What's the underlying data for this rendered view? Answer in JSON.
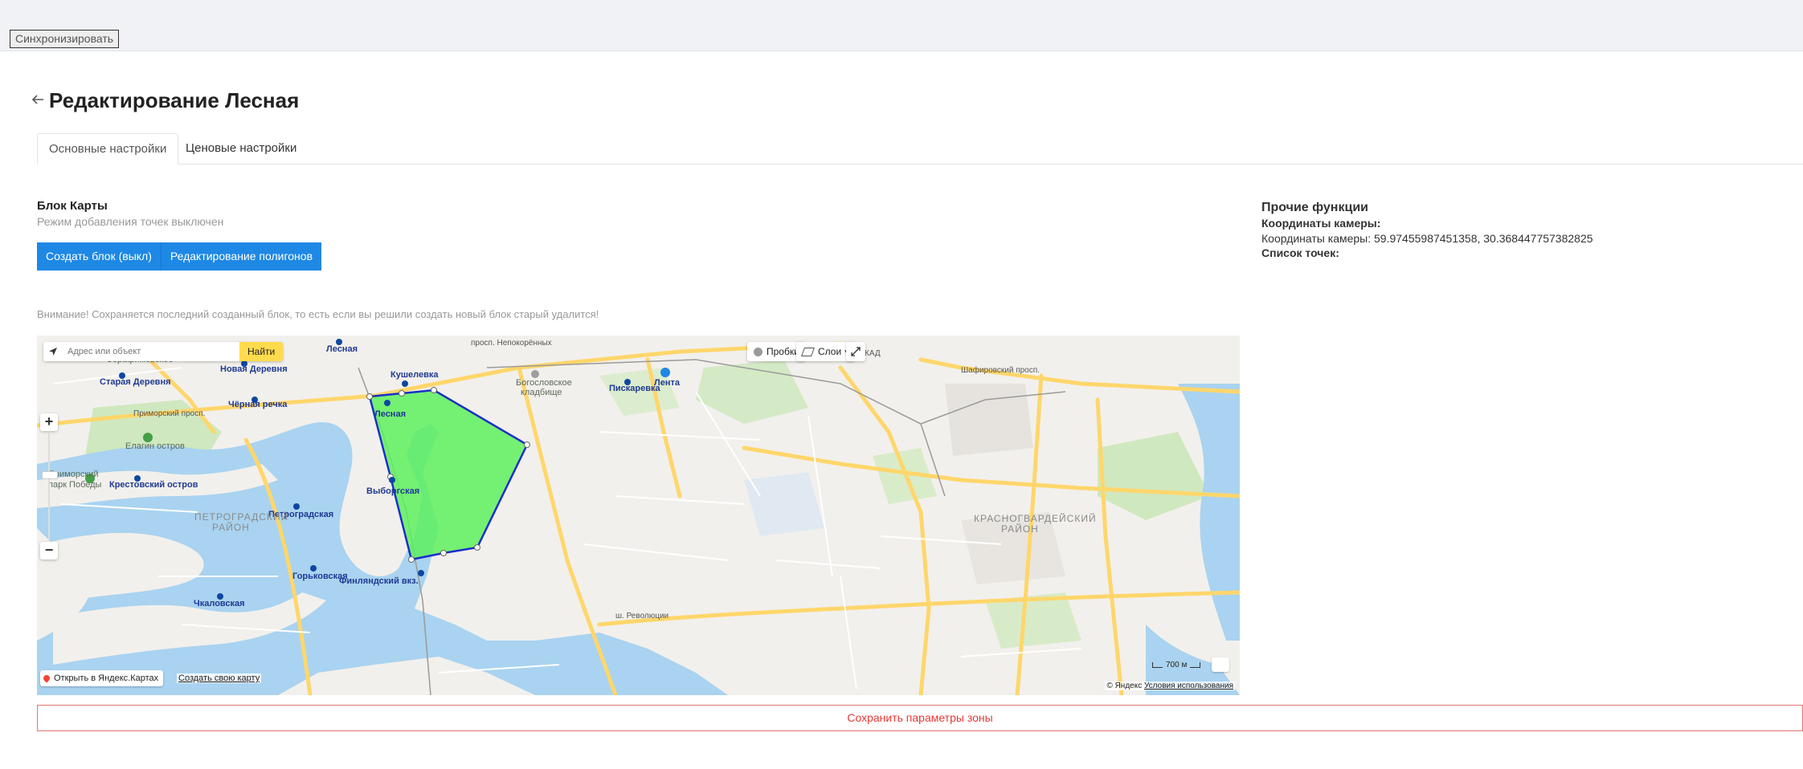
{
  "header": {
    "sync_label": "Синхронизировать"
  },
  "page": {
    "title": "Редактирование Лесная"
  },
  "tabs": [
    {
      "label": "Основные настройки",
      "active": true
    },
    {
      "label": "Ценовые настройки",
      "active": false
    }
  ],
  "map_block": {
    "title": "Блок Карты",
    "subtitle": "Режим добавления точек выключен",
    "buttons": [
      {
        "label": "Создать блок (выкл)"
      },
      {
        "label": "Редактирование полигонов"
      }
    ],
    "warning": "Внимание! Сохраняется последний созданный блок, то есть если вы решили создать новый блок старый удалится!"
  },
  "other_functions": {
    "title": "Прочие функции",
    "camera_label": "Координаты камеры:",
    "camera_value": "Координаты камеры: 59.97455987451358, 30.368447757382825",
    "points_label": "Список точек:"
  },
  "map": {
    "search_placeholder": "Адрес или объект",
    "find_label": "Найти",
    "traffic_label": "Пробки",
    "layers_label": "Слои",
    "open_yandex": "Открыть в Яндекс.Картах",
    "create_map": "Создать свою карту",
    "copyright": "© Яндекс",
    "terms": "Условия использования",
    "scale": "700 м",
    "polygon_fill": "#5ef05e",
    "polygon_stroke": "#1a2fc8",
    "labels": {
      "lesnaya": "Лесная",
      "vyborgskaya": "Выборгская",
      "kushelevka": "Кушелевка",
      "piskarevka": "Пискаревка",
      "lenta": "Лента",
      "novaya_derevnya": "Новая Деревня",
      "staraya_derevnya": "Старая Деревня",
      "chernaya_rechka": "Чёрная речка",
      "elagin": "Елагин остров",
      "krestovsky": "Крестовский остров",
      "petrogradsky": "ПЕТРОГРАДСКИЙ",
      "rayon": "РАЙОН",
      "petrogradskaya": "Петроградская",
      "chkalovskaya": "Чкаловская",
      "gorkovskaya": "Горьковская",
      "finlyandsky": "Финляндский вкз.",
      "krasnogvardeysky": "КРАСНОГВАРДЕЙСКИЙ",
      "bogoslovskoe": "Богословское",
      "kladbishe": "кладбище",
      "serafimovskoe": "Серафимовское",
      "primorsky_park": "Приморский",
      "park_pobedy": "парк Победы",
      "lesnaya_kladb": "Лесная",
      "sh_revolyutsii": "ш. Революции",
      "prim_prosp": "Приморский просп.",
      "prosp_nepok": "просп. Непокорённых",
      "shafirovsky": "Шафировский просп.",
      "kad": "КАД"
    }
  }
}
